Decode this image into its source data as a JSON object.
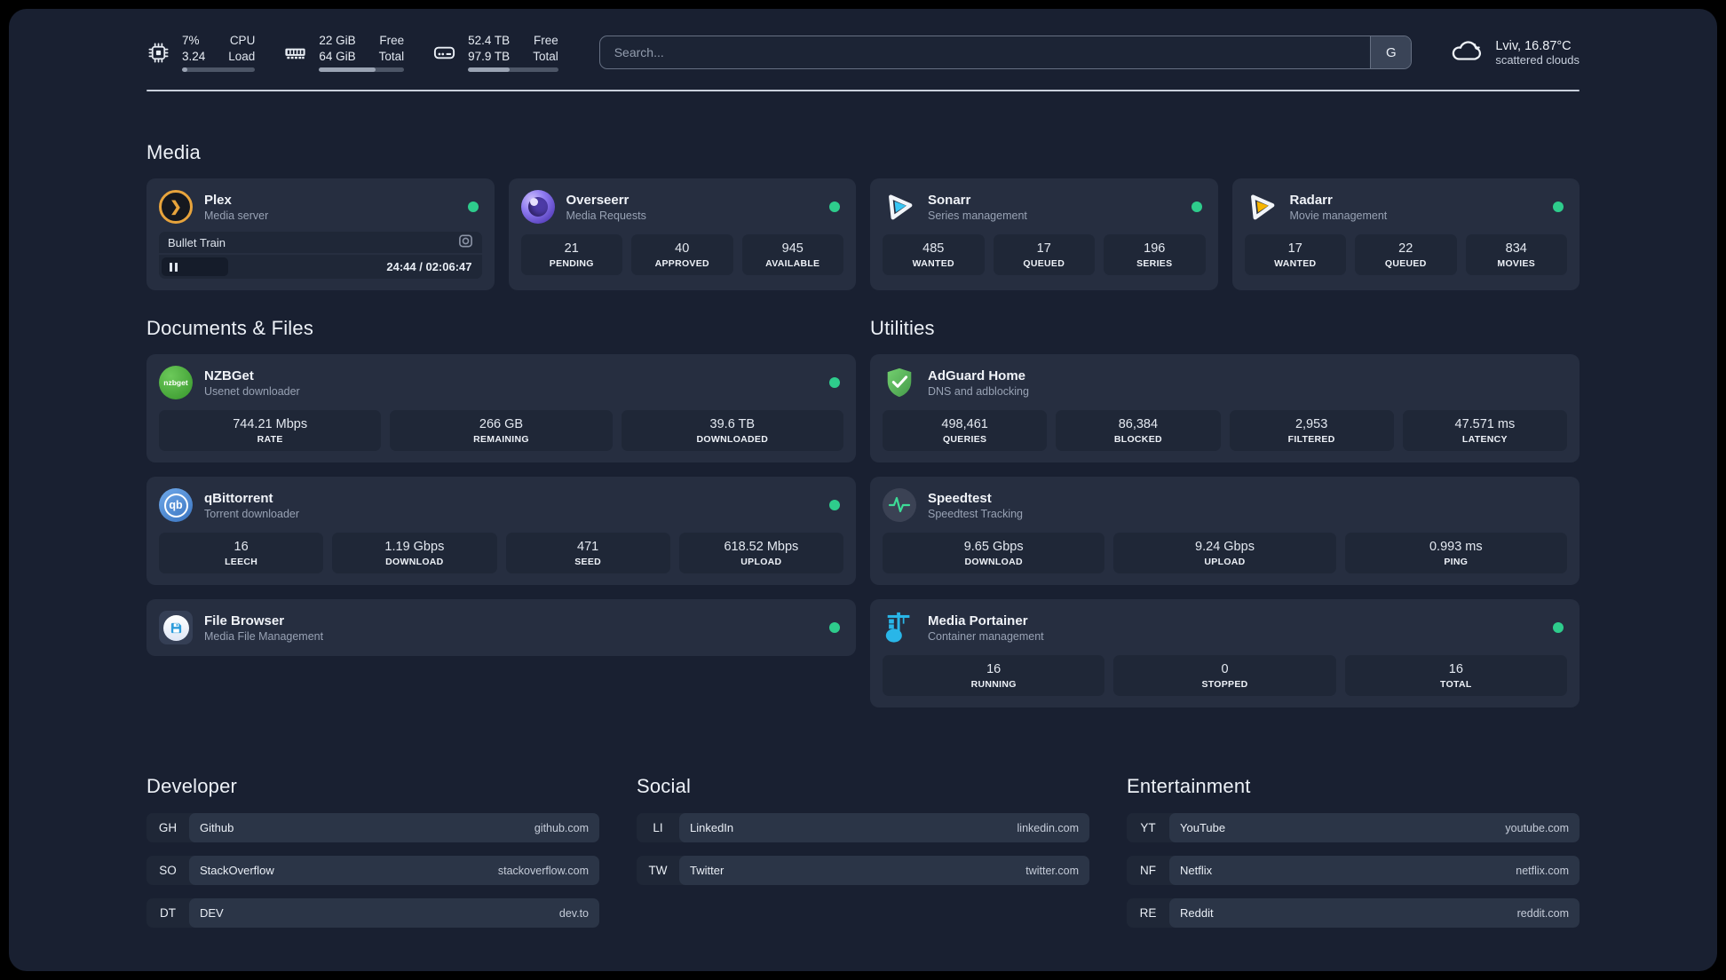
{
  "colors": {
    "status_green": "#2ecc8c",
    "plex_orange": "#e8a43c",
    "sonarr_blue": "#38c6f4",
    "radarr_orange": "#f7b500",
    "portainer_blue": "#29b6e8"
  },
  "topbar": {
    "stats": [
      {
        "name": "cpu",
        "value_top": "7%",
        "value_bottom": "3.24",
        "label_top": "CPU",
        "label_bottom": "Load",
        "percent": 7
      },
      {
        "name": "memory",
        "value_top": "22 GiB",
        "value_bottom": "64 GiB",
        "label_top": "Free",
        "label_bottom": "Total",
        "percent": 66
      },
      {
        "name": "disk",
        "value_top": "52.4 TB",
        "value_bottom": "97.9 TB",
        "label_top": "Free",
        "label_bottom": "Total",
        "percent": 46
      }
    ],
    "search": {
      "placeholder": "Search...",
      "button_label": "G"
    },
    "weather": {
      "line1": "Lviv, 16.87°C",
      "line2": "scattered clouds"
    }
  },
  "sections": {
    "media": "Media",
    "documents": "Documents & Files",
    "utilities": "Utilities",
    "developer": "Developer",
    "social": "Social",
    "entertainment": "Entertainment"
  },
  "services": {
    "plex": {
      "title": "Plex",
      "subtitle": "Media server",
      "icon_glyph": "❯",
      "now_playing": "Bullet Train",
      "time": "24:44 / 02:06:47"
    },
    "overseerr": {
      "title": "Overseerr",
      "subtitle": "Media Requests",
      "stats": [
        {
          "value": "21",
          "label": "PENDING"
        },
        {
          "value": "40",
          "label": "APPROVED"
        },
        {
          "value": "945",
          "label": "AVAILABLE"
        }
      ]
    },
    "sonarr": {
      "title": "Sonarr",
      "subtitle": "Series management",
      "stats": [
        {
          "value": "485",
          "label": "WANTED"
        },
        {
          "value": "17",
          "label": "QUEUED"
        },
        {
          "value": "196",
          "label": "SERIES"
        }
      ]
    },
    "radarr": {
      "title": "Radarr",
      "subtitle": "Movie management",
      "stats": [
        {
          "value": "17",
          "label": "WANTED"
        },
        {
          "value": "22",
          "label": "QUEUED"
        },
        {
          "value": "834",
          "label": "MOVIES"
        }
      ]
    },
    "nzbget": {
      "title": "NZBGet",
      "subtitle": "Usenet downloader",
      "icon_text": "nzbget",
      "stats": [
        {
          "value": "744.21 Mbps",
          "label": "RATE"
        },
        {
          "value": "266 GB",
          "label": "REMAINING"
        },
        {
          "value": "39.6 TB",
          "label": "DOWNLOADED"
        }
      ]
    },
    "qbittorrent": {
      "title": "qBittorrent",
      "subtitle": "Torrent downloader",
      "icon_text": "qb",
      "stats": [
        {
          "value": "16",
          "label": "LEECH"
        },
        {
          "value": "1.19 Gbps",
          "label": "DOWNLOAD"
        },
        {
          "value": "471",
          "label": "SEED"
        },
        {
          "value": "618.52 Mbps",
          "label": "UPLOAD"
        }
      ]
    },
    "filebrowser": {
      "title": "File Browser",
      "subtitle": "Media File Management"
    },
    "adguard": {
      "title": "AdGuard Home",
      "subtitle": "DNS and adblocking",
      "stats": [
        {
          "value": "498,461",
          "label": "QUERIES"
        },
        {
          "value": "86,384",
          "label": "BLOCKED"
        },
        {
          "value": "2,953",
          "label": "FILTERED"
        },
        {
          "value": "47.571 ms",
          "label": "LATENCY"
        }
      ]
    },
    "speedtest": {
      "title": "Speedtest",
      "subtitle": "Speedtest Tracking",
      "stats": [
        {
          "value": "9.65 Gbps",
          "label": "DOWNLOAD"
        },
        {
          "value": "9.24 Gbps",
          "label": "UPLOAD"
        },
        {
          "value": "0.993 ms",
          "label": "PING"
        }
      ]
    },
    "portainer": {
      "title": "Media Portainer",
      "subtitle": "Container management",
      "stats": [
        {
          "value": "16",
          "label": "RUNNING"
        },
        {
          "value": "0",
          "label": "STOPPED"
        },
        {
          "value": "16",
          "label": "TOTAL"
        }
      ]
    }
  },
  "bookmarks": {
    "developer": [
      {
        "abbr": "GH",
        "name": "Github",
        "url": "github.com"
      },
      {
        "abbr": "SO",
        "name": "StackOverflow",
        "url": "stackoverflow.com"
      },
      {
        "abbr": "DT",
        "name": "DEV",
        "url": "dev.to"
      }
    ],
    "social": [
      {
        "abbr": "LI",
        "name": "LinkedIn",
        "url": "linkedin.com"
      },
      {
        "abbr": "TW",
        "name": "Twitter",
        "url": "twitter.com"
      }
    ],
    "entertainment": [
      {
        "abbr": "YT",
        "name": "YouTube",
        "url": "youtube.com"
      },
      {
        "abbr": "NF",
        "name": "Netflix",
        "url": "netflix.com"
      },
      {
        "abbr": "RE",
        "name": "Reddit",
        "url": "reddit.com"
      }
    ]
  }
}
